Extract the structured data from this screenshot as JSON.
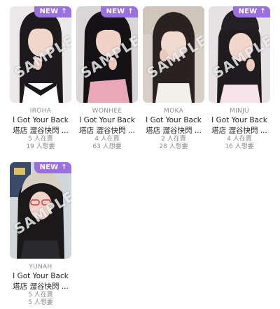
{
  "badge": {
    "label": "NEW",
    "arrow": "↑"
  },
  "watermark": "SAMPLE",
  "colors": {
    "badge": "#9a6fe0",
    "muted_text": "#8c8c8c"
  },
  "cards": [
    {
      "member": "IROHA",
      "title_line1": "I Got Your Back",
      "title_line2": "塔店 澀谷快閃 ...",
      "selling": "5 人在賣",
      "wanting": "19 人想要"
    },
    {
      "member": "WONHEE",
      "title_line1": "I Got Your Back",
      "title_line2": "塔店 澀谷快閃 ...",
      "selling": "4 人在賣",
      "wanting": "63 人想要"
    },
    {
      "member": "MOKA",
      "title_line1": "I Got Your Back",
      "title_line2": "塔店 澀谷快閃 ...",
      "selling": "2 人在賣",
      "wanting": "28 人想要"
    },
    {
      "member": "MINJU",
      "title_line1": "I Got Your Back",
      "title_line2": "塔店 澀谷快閃 ...",
      "selling": "4 人在賣",
      "wanting": "16 人想要"
    },
    {
      "member": "YUNAH",
      "title_line1": "I Got Your Back",
      "title_line2": "塔店 澀谷快閃 ...",
      "selling": "5 人在賣",
      "wanting": "5 人想要"
    }
  ]
}
